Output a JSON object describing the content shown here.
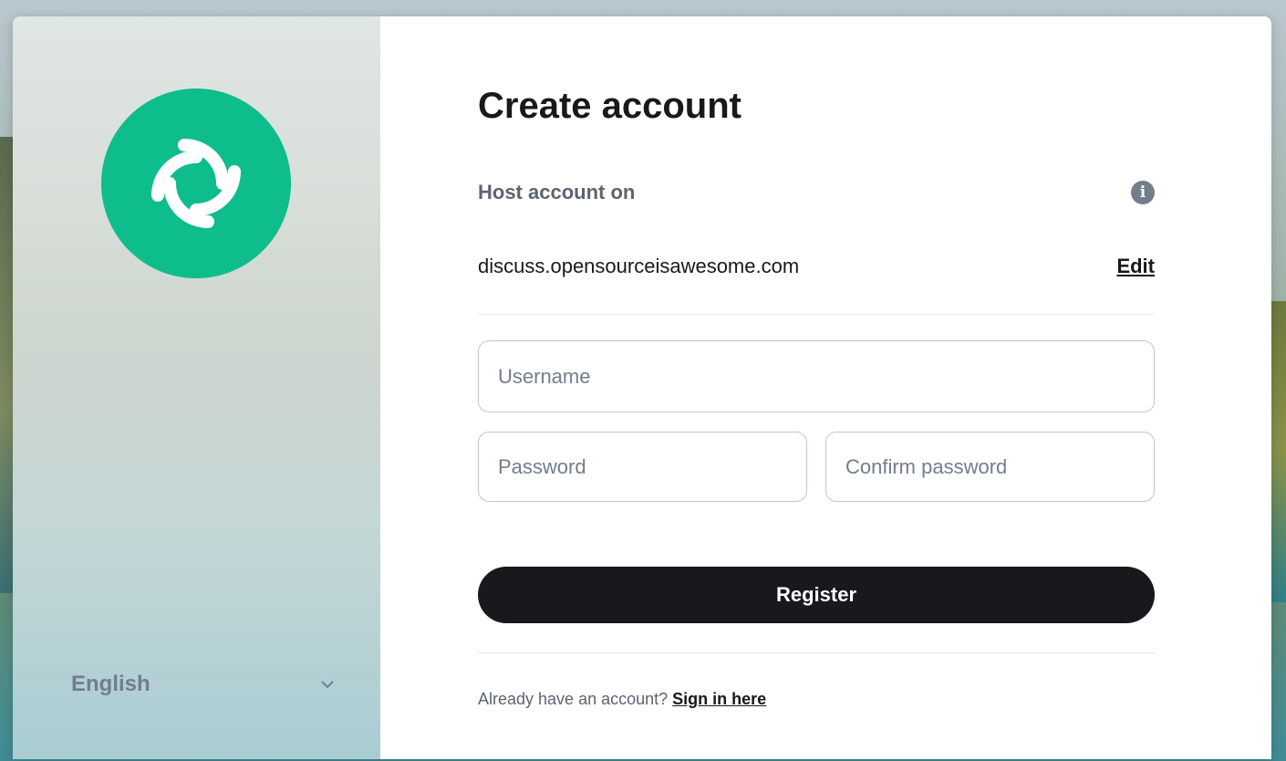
{
  "side": {
    "language": "English"
  },
  "form": {
    "title": "Create account",
    "host_label": "Host account on",
    "server_name": "discuss.opensourceisawesome.com",
    "edit_label": "Edit",
    "username_placeholder": "Username",
    "password_placeholder": "Password",
    "confirm_placeholder": "Confirm password",
    "register_label": "Register",
    "already_text": "Already have an account?",
    "signin_label": "Sign in here"
  },
  "colors": {
    "brand": "#0dbd8b",
    "primary_button": "#17191c"
  },
  "icons": {
    "logo": "element-logo",
    "info": "info-icon",
    "chevron": "chevron-down-icon"
  }
}
